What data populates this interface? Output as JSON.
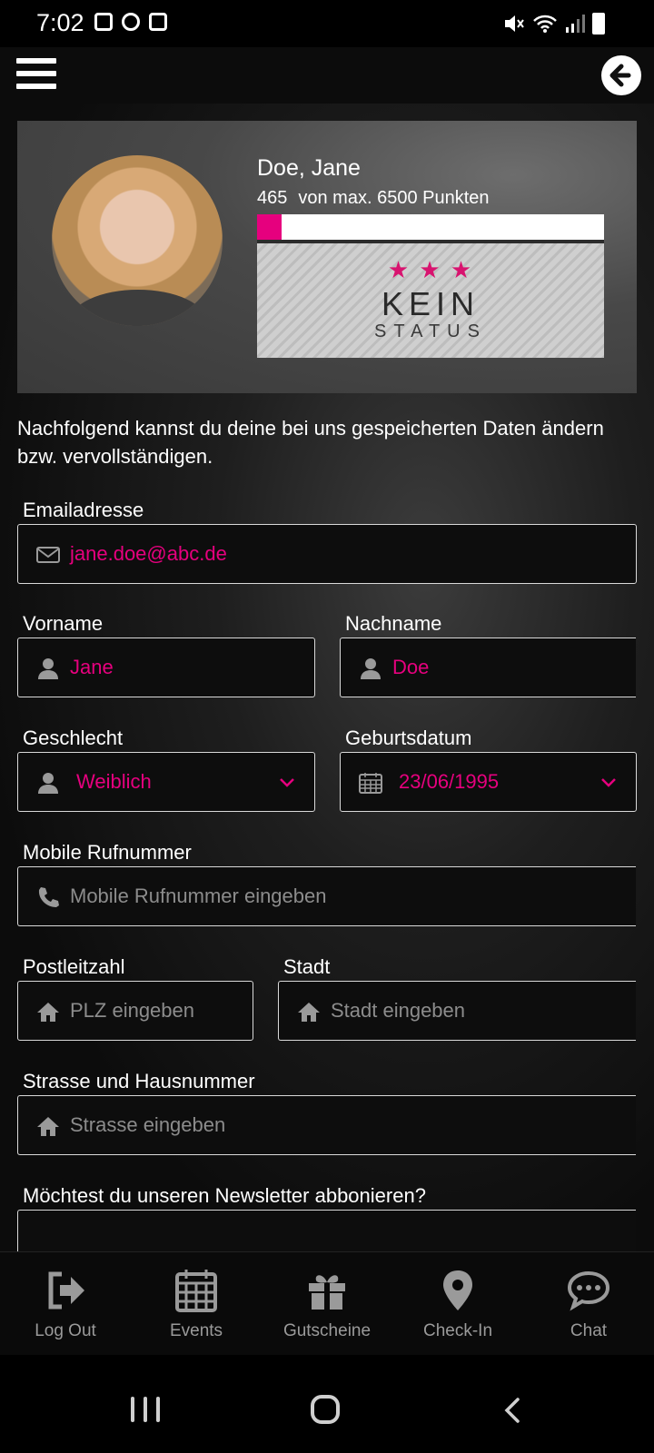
{
  "status_bar": {
    "time": "7:02"
  },
  "profile": {
    "name": "Doe, Jane",
    "points": "465",
    "points_suffix": "von max. 6500 Punkten",
    "progress_fraction": 0.0715,
    "badge_line1": "KEIN",
    "badge_line2": "STATUS",
    "accent_color": "#e6007e"
  },
  "intro_text": "Nachfolgend kannst du deine bei uns gespeicherten Daten ändern bzw. vervollständigen.",
  "form": {
    "email": {
      "label": "Emailadresse",
      "value": "jane.doe@abc.de",
      "icon": "envelope-icon"
    },
    "firstname": {
      "label": "Vorname",
      "value": "Jane",
      "icon": "user-icon"
    },
    "lastname": {
      "label": "Nachname",
      "value": "Doe",
      "icon": "user-icon"
    },
    "gender": {
      "label": "Geschlecht",
      "value": "Weiblich",
      "icon": "user-icon"
    },
    "birthdate": {
      "label": "Geburtsdatum",
      "value": "23/06/1995",
      "icon": "calendar-icon"
    },
    "mobile": {
      "label": "Mobile Rufnummer",
      "placeholder": "Mobile Rufnummer eingeben",
      "icon": "phone-icon"
    },
    "zip": {
      "label": "Postleitzahl",
      "placeholder": "PLZ eingeben",
      "icon": "home-icon"
    },
    "city": {
      "label": "Stadt",
      "placeholder": "Stadt eingeben",
      "icon": "home-icon"
    },
    "street": {
      "label": "Strasse und Hausnummer",
      "placeholder": "Strasse eingeben",
      "icon": "home-icon"
    },
    "newsletter": {
      "label": "Möchtest du unseren Newsletter abbonieren?"
    }
  },
  "bottom_nav": [
    {
      "label": "Log Out",
      "icon": "logout-icon"
    },
    {
      "label": "Events",
      "icon": "calendar-icon"
    },
    {
      "label": "Gutscheine",
      "icon": "gift-icon"
    },
    {
      "label": "Check-In",
      "icon": "location-pin-icon"
    },
    {
      "label": "Chat",
      "icon": "chat-bubble-icon"
    }
  ]
}
